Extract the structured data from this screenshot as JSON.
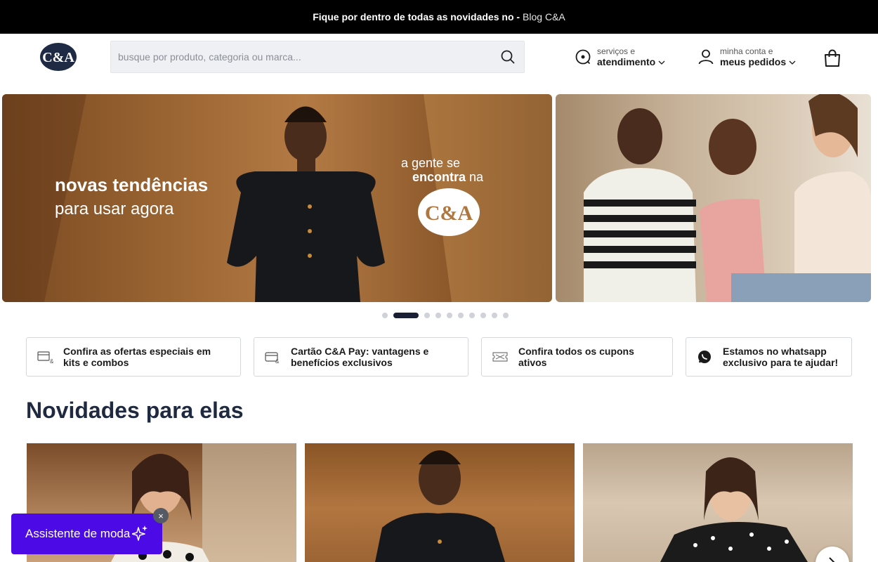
{
  "topbar": {
    "text": "Fique por dentro de todas as novidades no -",
    "link": "Blog C&A"
  },
  "header": {
    "logo_text": "C&A",
    "search": {
      "placeholder": "busque por produto, categoria ou marca..."
    },
    "services": {
      "small": "serviços e",
      "big": "atendimento"
    },
    "account": {
      "small": "minha conta e",
      "big": "meus pedidos"
    }
  },
  "banner": {
    "headline": "novas tendências",
    "subheadline": "para usar agora",
    "tag_line1": "a gente se",
    "tag_line2_bold": "encontra",
    "tag_line2_rest": "na",
    "logo_text": "C&A",
    "dots_count": 10,
    "active_dot": 1
  },
  "benefits": [
    {
      "icon": "price-tag-icon",
      "label": "Confira as ofertas especiais em kits e combos"
    },
    {
      "icon": "credit-card-icon",
      "label": "Cartão C&A Pay: vantagens e benefícios exclusivos"
    },
    {
      "icon": "coupon-icon",
      "label": "Confira todos os cupons ativos"
    },
    {
      "icon": "whatsapp-icon",
      "label": "Estamos no whatsapp exclusivo para te ajudar!"
    }
  ],
  "section": {
    "title": "Novidades para elas"
  },
  "assistant": {
    "label": "Assistente de moda",
    "close": "×"
  },
  "colors": {
    "assistant": "#4b0ae6",
    "topbar": "#000000",
    "title": "#1f2a40"
  }
}
